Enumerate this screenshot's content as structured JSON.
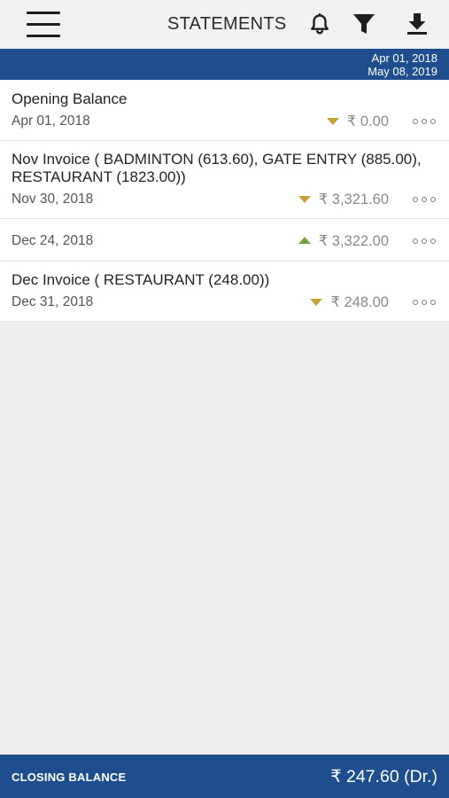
{
  "header": {
    "title": "STATEMENTS",
    "icons": [
      "menu-icon",
      "bell-icon",
      "filter-icon",
      "download-icon"
    ]
  },
  "date_range": {
    "from": "Apr 01, 2018",
    "to": "May 08, 2019"
  },
  "transactions": [
    {
      "description": "Opening Balance",
      "date": "Apr 01, 2018",
      "amount": "₹ 0.00",
      "direction": "down"
    },
    {
      "description": "Nov Invoice (  BADMINTON  (613.60), GATE ENTRY (885.00), RESTAURANT (1823.00))",
      "date": "Nov 30, 2018",
      "amount": "₹ 3,321.60",
      "direction": "down"
    },
    {
      "description": "",
      "date": "Dec 24, 2018",
      "amount": "₹ 3,322.00",
      "direction": "up"
    },
    {
      "description": "Dec Invoice ( RESTAURANT (248.00))",
      "date": "Dec 31, 2018",
      "amount": "₹ 248.00",
      "direction": "down"
    }
  ],
  "footer": {
    "label": "CLOSING BALANCE",
    "value": "₹ 247.60 (Dr.)"
  },
  "colors": {
    "primary": "#1f4e8e",
    "debit_arrow": "#c6a23c",
    "credit_arrow": "#7aa43a",
    "background": "#efefef"
  }
}
